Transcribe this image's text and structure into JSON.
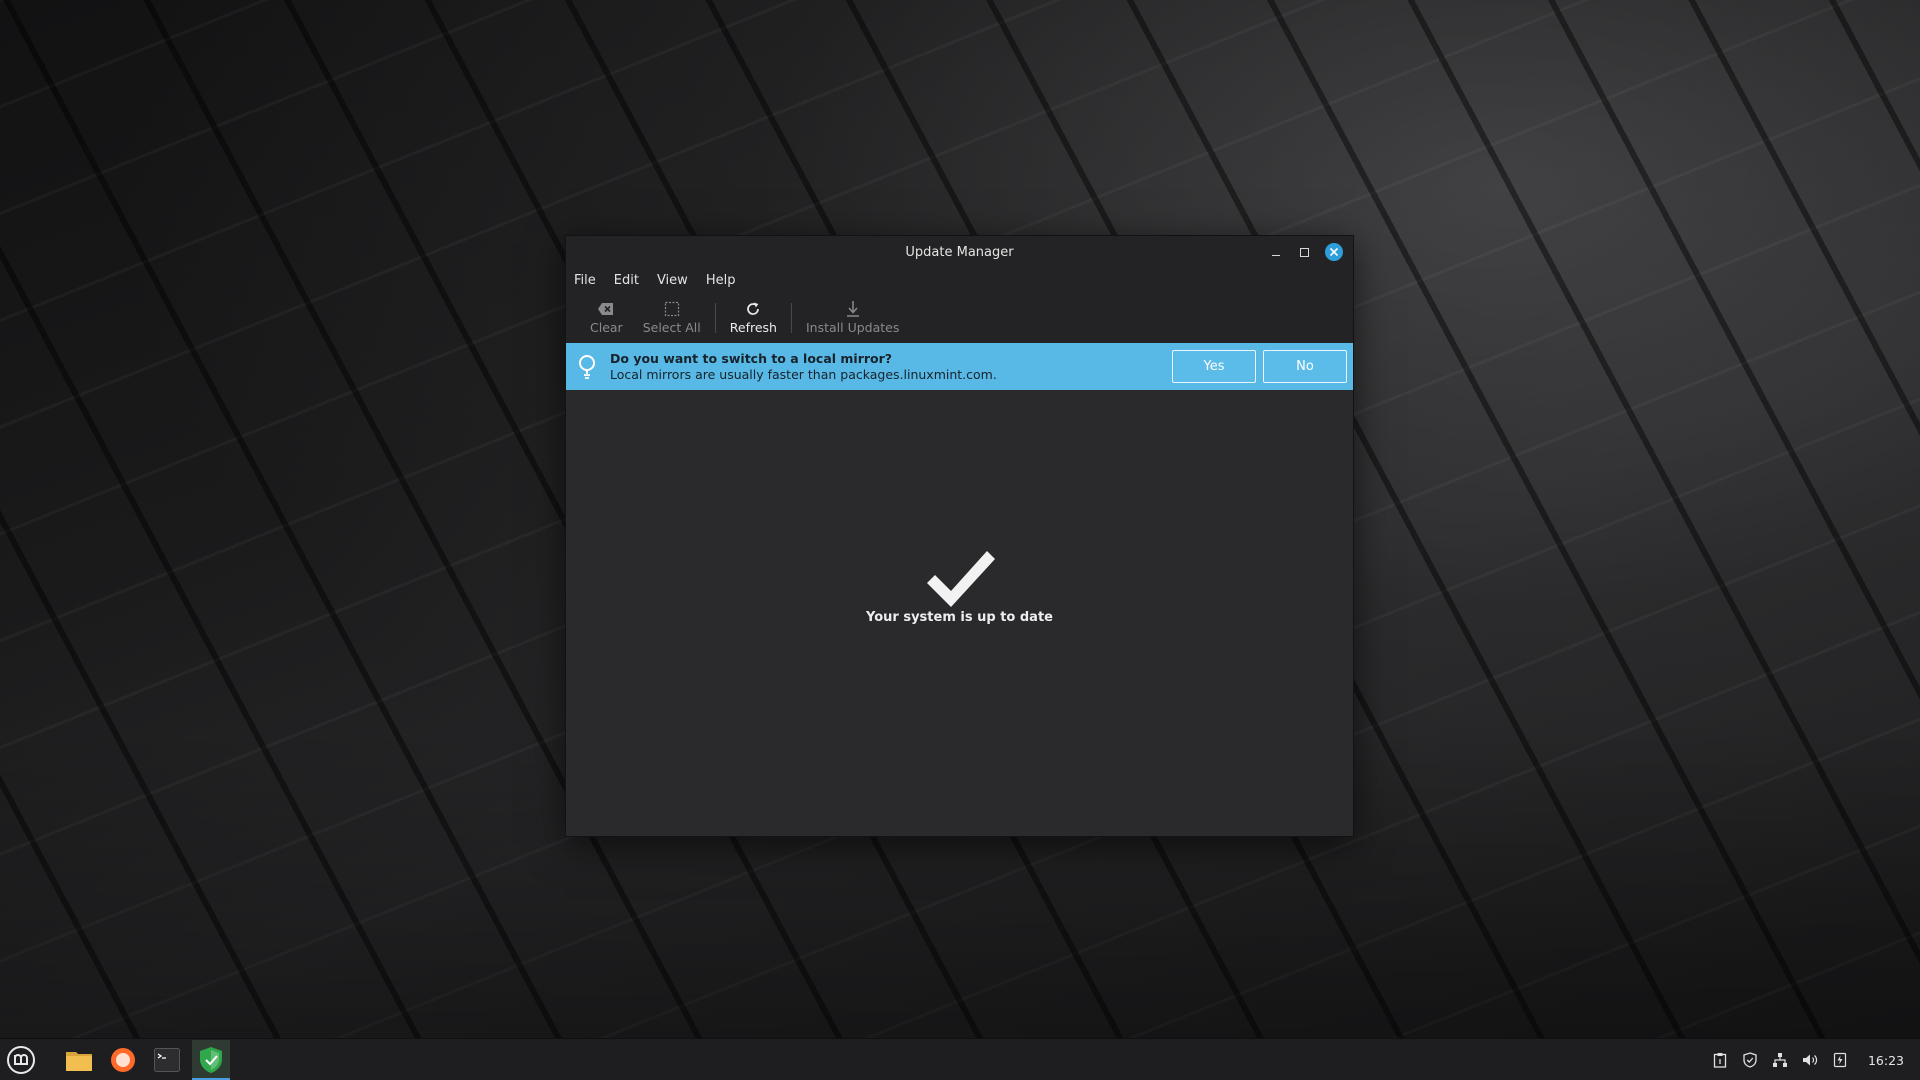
{
  "window": {
    "title": "Update Manager"
  },
  "menubar": {
    "items": [
      "File",
      "Edit",
      "View",
      "Help"
    ]
  },
  "toolbar": {
    "clear": "Clear",
    "select_all": "Select All",
    "refresh": "Refresh",
    "install_updates": "Install Updates"
  },
  "infobar": {
    "title": "Do you want to switch to a local mirror?",
    "body": "Local mirrors are usually faster than packages.linuxmint.com.",
    "yes": "Yes",
    "no": "No",
    "color": "#58b9e7"
  },
  "status": {
    "message": "Your system is up to date"
  },
  "taskbar": {
    "clock": "16:23",
    "launchers": [
      "files-icon",
      "firefox-icon",
      "terminal-icon",
      "update-manager-icon"
    ]
  },
  "colors": {
    "accent": "#2e9fdc",
    "window_bg": "#2a2a2d",
    "header_bg": "#232325"
  }
}
